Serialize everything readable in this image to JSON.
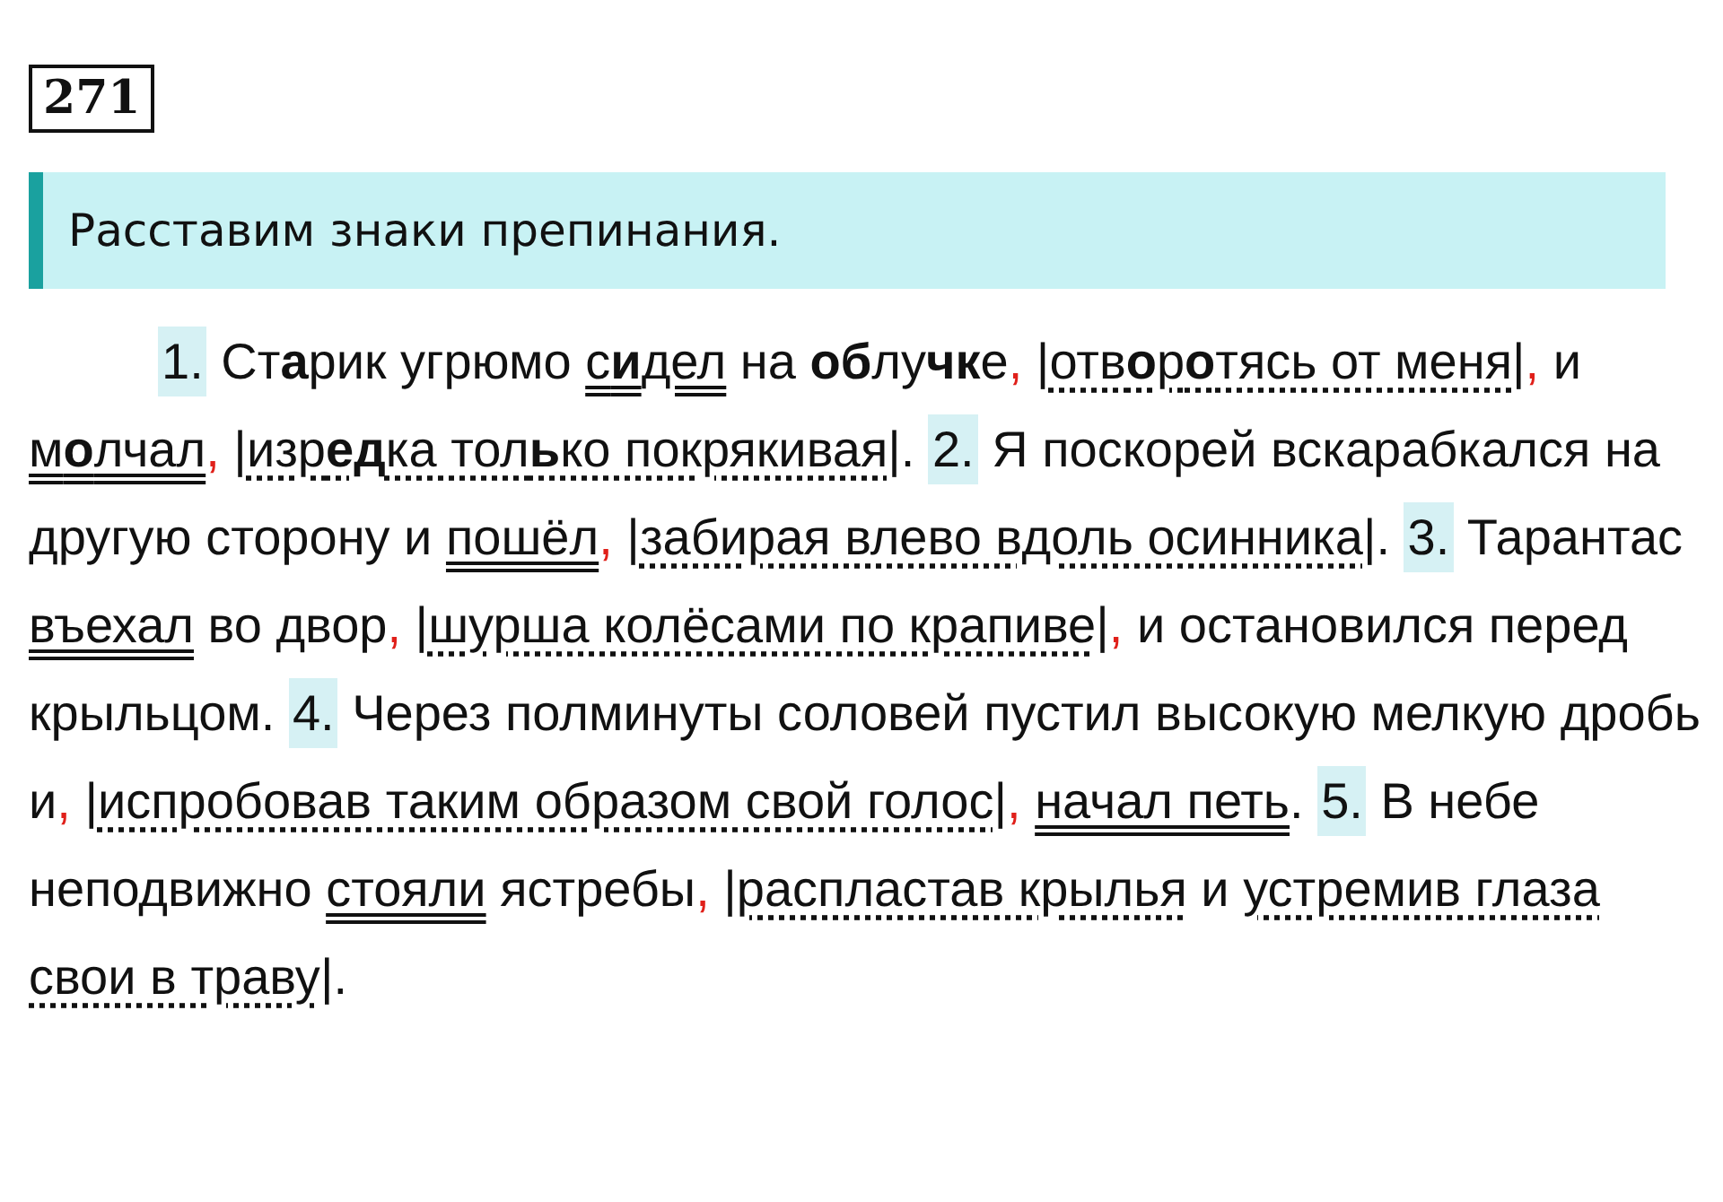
{
  "exercise_number": "271",
  "instruction": "Расставим знаки препинания.",
  "paragraph": [
    {
      "kind": "number",
      "text": "1."
    },
    {
      "kind": "text",
      "text": " Ст**а**рик угрюмо "
    },
    {
      "kind": "predicate",
      "text": "с**и**дел"
    },
    {
      "kind": "text",
      "text": " на **об**лу**чк**е"
    },
    {
      "kind": "comma",
      "text": ","
    },
    {
      "kind": "text",
      "text": " |"
    },
    {
      "kind": "participle",
      "text": "отв**о**р**о**тясь от меня"
    },
    {
      "kind": "text",
      "text": "|"
    },
    {
      "kind": "comma",
      "text": ","
    },
    {
      "kind": "text",
      "text": " и "
    },
    {
      "kind": "predicate",
      "text": "м**о**лчал"
    },
    {
      "kind": "comma",
      "text": ","
    },
    {
      "kind": "text",
      "text": " |"
    },
    {
      "kind": "participle",
      "text": "изр**ед**ка тол**ь**ко покрякивая"
    },
    {
      "kind": "text",
      "text": "|. "
    },
    {
      "kind": "number",
      "text": "2."
    },
    {
      "kind": "text",
      "text": " Я поскорей вскарабкался на другую сторону и "
    },
    {
      "kind": "predicate",
      "text": "пошёл"
    },
    {
      "kind": "comma",
      "text": ","
    },
    {
      "kind": "text",
      "text": " |"
    },
    {
      "kind": "participle",
      "text": "забирая влево вдоль осинника"
    },
    {
      "kind": "text",
      "text": "|. "
    },
    {
      "kind": "number",
      "text": "3."
    },
    {
      "kind": "text",
      "text": " Тарантас "
    },
    {
      "kind": "predicate",
      "text": "въехал"
    },
    {
      "kind": "text",
      "text": " во двор"
    },
    {
      "kind": "comma",
      "text": ","
    },
    {
      "kind": "text",
      "text": " |"
    },
    {
      "kind": "participle",
      "text": "шурша колёсами по крапиве"
    },
    {
      "kind": "text",
      "text": "|"
    },
    {
      "kind": "comma",
      "text": ","
    },
    {
      "kind": "text",
      "text": " и остановился перед крыльцом. "
    },
    {
      "kind": "number",
      "text": "4."
    },
    {
      "kind": "text",
      "text": " Через полминуты соловей пустил высокую мелкую дробь и"
    },
    {
      "kind": "comma",
      "text": ","
    },
    {
      "kind": "text",
      "text": " |"
    },
    {
      "kind": "participle",
      "text": "испробовав таким образом свой голос"
    },
    {
      "kind": "text",
      "text": "|"
    },
    {
      "kind": "comma",
      "text": ", "
    },
    {
      "kind": "predicate",
      "text": "начал петь"
    },
    {
      "kind": "text",
      "text": ". "
    },
    {
      "kind": "number",
      "text": "5."
    },
    {
      "kind": "text",
      "text": " В небе неподвижно "
    },
    {
      "kind": "predicate",
      "text": "стояли"
    },
    {
      "kind": "text",
      "text": " ястребы"
    },
    {
      "kind": "comma",
      "text": ","
    },
    {
      "kind": "text",
      "text": " |"
    },
    {
      "kind": "participle",
      "text": "распластав крылья"
    },
    {
      "kind": "text",
      "text": " и "
    },
    {
      "kind": "participle",
      "text": "устремив глаза свои в траву"
    },
    {
      "kind": "text",
      "text": "|."
    }
  ]
}
